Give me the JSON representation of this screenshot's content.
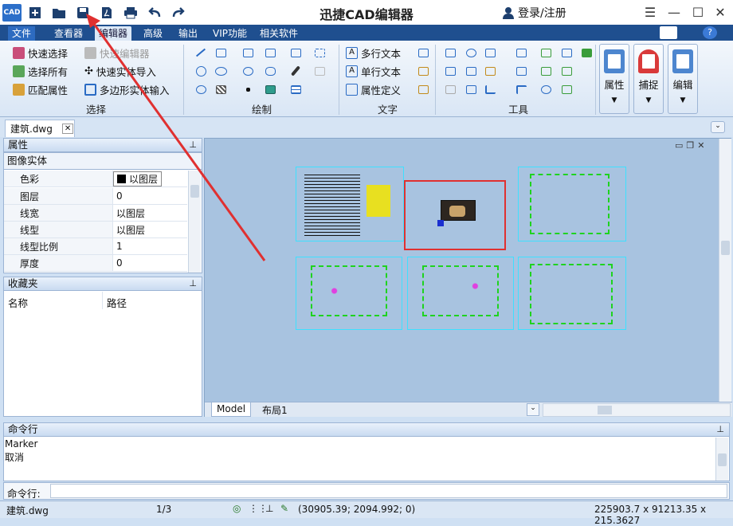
{
  "titlebar": {
    "app_icon_text": "CAD",
    "title": "迅捷CAD编辑器",
    "login": "登录/注册"
  },
  "menu": {
    "tabs": [
      "文件",
      "查看器",
      "编辑器",
      "高级",
      "输出",
      "VIP功能",
      "相关软件"
    ],
    "active": "编辑器"
  },
  "ribbon": {
    "select_group": {
      "label": "选择",
      "items": [
        "快速选择",
        "快速编辑器",
        "选择所有",
        "快速实体导入",
        "匹配属性",
        "多边形实体输入"
      ]
    },
    "draw_group": {
      "label": "绘制"
    },
    "text_group": {
      "label": "文字",
      "items": [
        "多行文本",
        "单行文本",
        "属性定义"
      ]
    },
    "tools_group": {
      "label": "工具"
    },
    "big_buttons": [
      "属性",
      "捕捉",
      "编辑"
    ]
  },
  "document": {
    "tab": "建筑.dwg"
  },
  "properties": {
    "title": "属性",
    "entity_type": "图像实体",
    "rows": [
      {
        "key": "色彩",
        "value": "以图层"
      },
      {
        "key": "图层",
        "value": "0"
      },
      {
        "key": "线宽",
        "value": "以图层"
      },
      {
        "key": "线型",
        "value": "以图层"
      },
      {
        "key": "线型比例",
        "value": "1"
      },
      {
        "key": "厚度",
        "value": "0"
      }
    ]
  },
  "favorites": {
    "title": "收藏夹",
    "col_name": "名称",
    "col_path": "路径"
  },
  "layout_tabs": [
    "Model",
    "布局1"
  ],
  "command": {
    "title": "命令行",
    "history": [
      "Marker",
      "取消"
    ],
    "prompt": "命令行:"
  },
  "status": {
    "file": "建筑.dwg",
    "page": "1/3",
    "coords": "(30905.39; 2094.992; 0)",
    "extent": "225903.7 x 91213.35 x 215.3627"
  },
  "colors": {
    "menubar": "#1f4f8f",
    "canvas": "#a8c3e0",
    "sheet_border": "#3ee0ff",
    "highlight": "#e03030"
  }
}
